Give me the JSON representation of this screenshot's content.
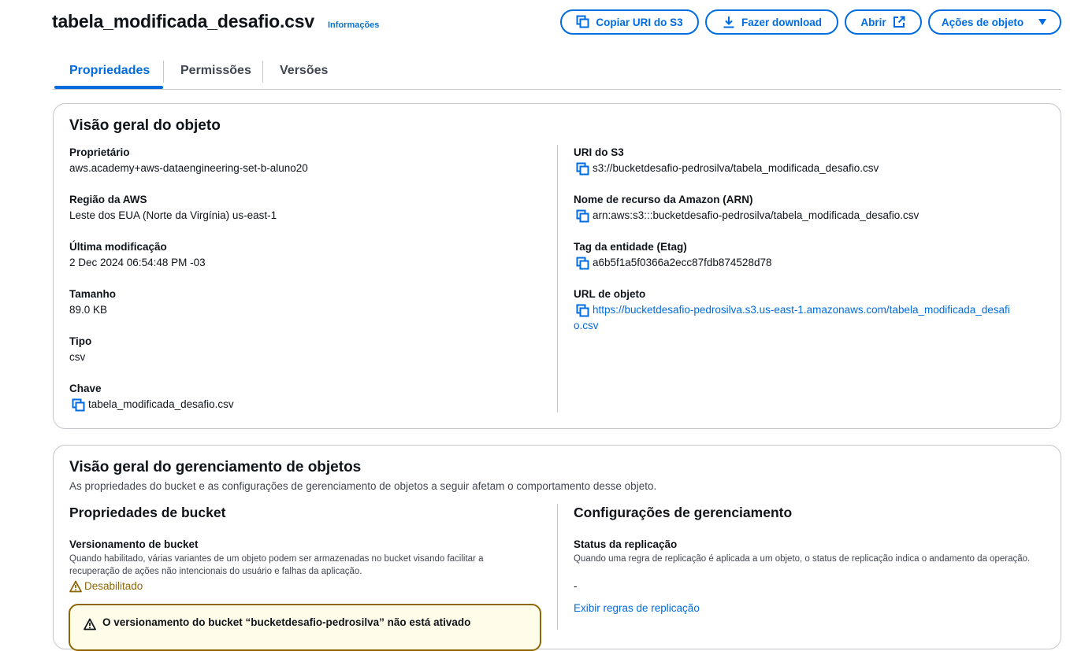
{
  "header": {
    "title": "tabela_modificada_desafio.csv",
    "info_link": "Informações",
    "buttons": {
      "copy_uri": "Copiar URI do S3",
      "download": "Fazer download",
      "open": "Abrir",
      "actions": "Ações de objeto"
    }
  },
  "tabs": [
    "Propriedades",
    "Permissões",
    "Versões"
  ],
  "overview": {
    "title": "Visão geral do objeto",
    "left": [
      {
        "label": "Proprietário",
        "value": "aws.academy+aws-dataengineering-set-b-aluno20"
      },
      {
        "label": "Região da AWS",
        "value": "Leste dos EUA (Norte da Virgínia) us-east-1"
      },
      {
        "label": "Última modificação",
        "value": "2 Dec 2024 06:54:48 PM -03"
      },
      {
        "label": "Tamanho",
        "value": "89.0 KB"
      },
      {
        "label": "Tipo",
        "value": "csv"
      },
      {
        "label": "Chave",
        "value": "tabela_modificada_desafio.csv"
      }
    ],
    "right": [
      {
        "label": "URI do S3",
        "value": "s3://bucketdesafio-pedrosilva/tabela_modificada_desafio.csv"
      },
      {
        "label": "Nome de recurso da Amazon (ARN)",
        "value": "arn:aws:s3:::bucketdesafio-pedrosilva/tabela_modificada_desafio.csv"
      },
      {
        "label": "Tag da entidade (Etag)",
        "value": "a6b5f1a5f0366a2ecc87fdb874528d78"
      },
      {
        "label": "URL de objeto",
        "value_line1": "https://bucketdesafio-pedrosilva.s3.us-east-1.amazonaws.com/tabela_modificada_desafi",
        "value_line2": "o.csv"
      }
    ]
  },
  "management": {
    "title": "Visão geral do gerenciamento de objetos",
    "subtitle": "As propriedades do bucket e as configurações de gerenciamento de objetos a seguir afetam o comportamento desse objeto.",
    "bucket": {
      "title": "Propriedades de bucket",
      "versioning_label": "Versionamento de bucket",
      "versioning_desc": "Quando habilitado, várias variantes de um objeto podem ser armazenadas no bucket visando facilitar a recuperação de ações não intencionais do usuário e falhas da aplicação.",
      "versioning_status": "Desabilitado",
      "alert_text": "O versionamento do bucket “bucketdesafio-pedrosilva” não está ativado"
    },
    "config": {
      "title": "Configurações de gerenciamento",
      "replication_label": "Status da replicação",
      "replication_desc": "Quando uma regra de replicação é aplicada a um objeto, o status de replicação indica o andamento da operação.",
      "replication_value": "-",
      "replication_link": "Exibir regras de replicação"
    }
  },
  "colors": {
    "accent": "#006ce0",
    "warning": "#8d6605",
    "text": "#0f141a",
    "muted": "#424650"
  }
}
